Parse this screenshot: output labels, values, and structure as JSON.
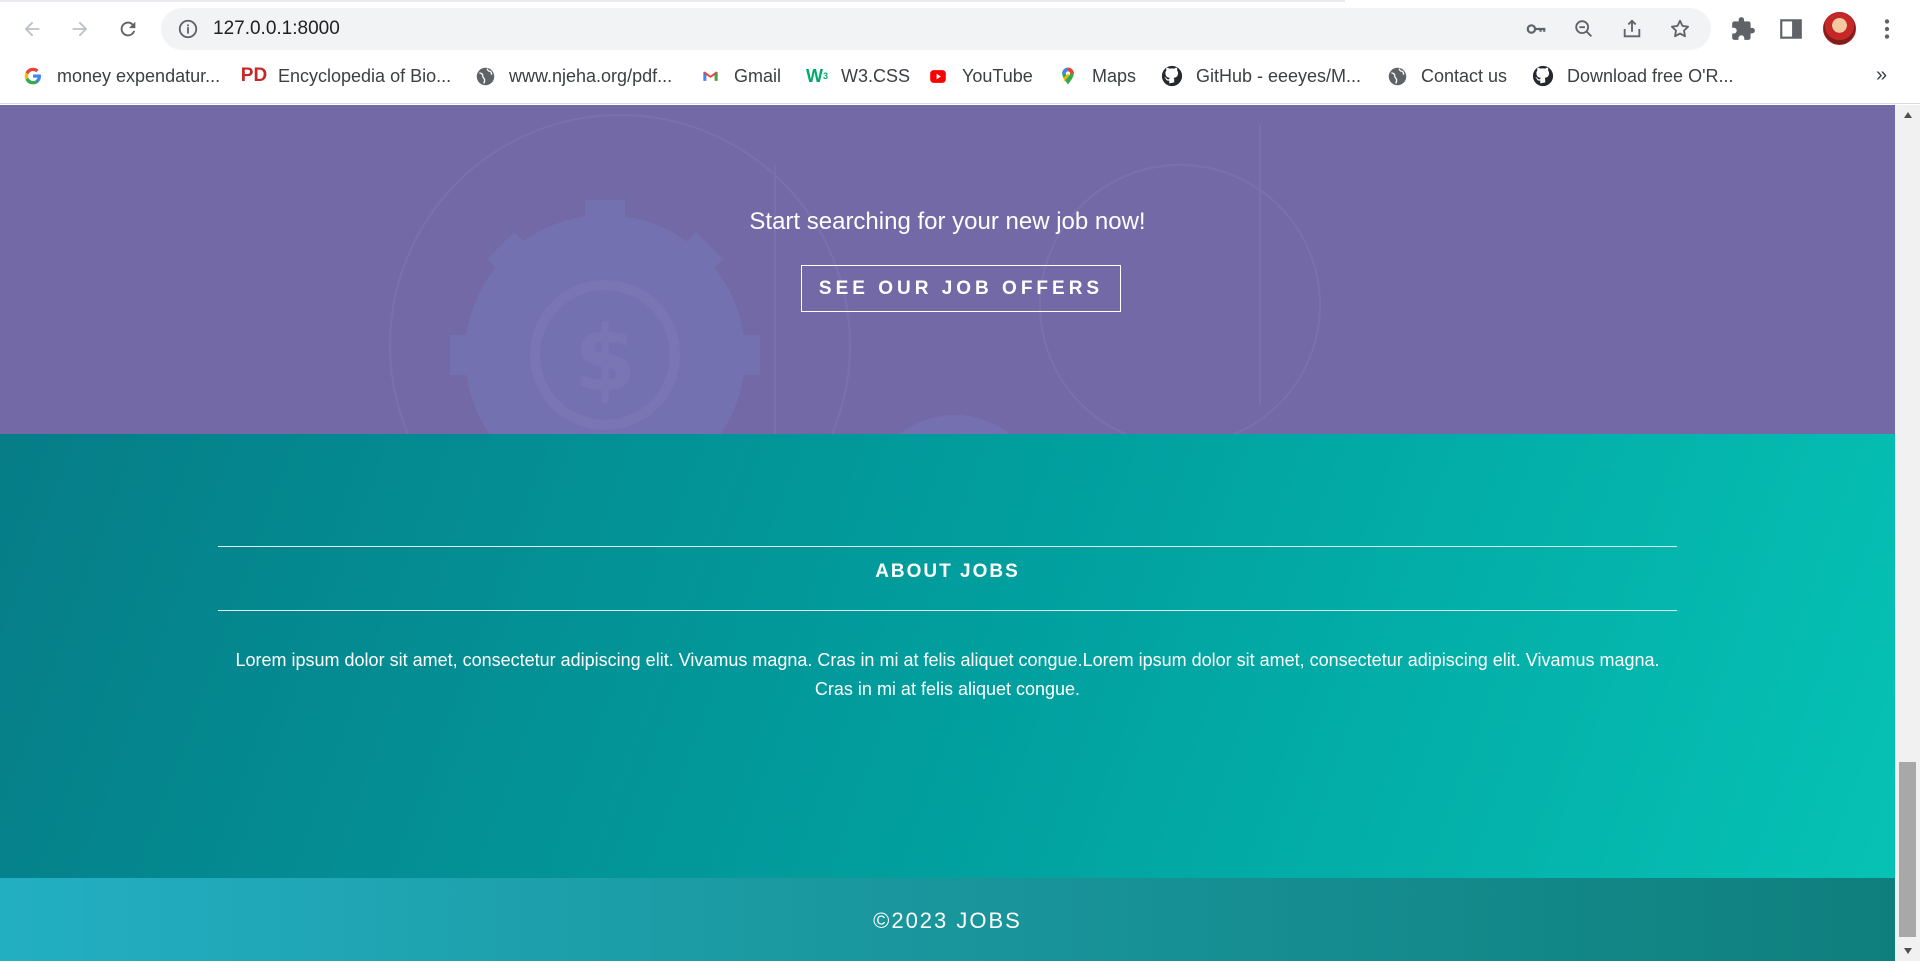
{
  "browser": {
    "url": "127.0.0.1:8000",
    "bookmarks": [
      {
        "label": "money expendatur...",
        "icon": "google-icon"
      },
      {
        "label": "Encyclopedia of Bio...",
        "icon": "pd-icon"
      },
      {
        "label": "www.njeha.org/pdf...",
        "icon": "globe-icon"
      },
      {
        "label": "Gmail",
        "icon": "gmail-icon"
      },
      {
        "label": "W3.CSS",
        "icon": "w3-icon"
      },
      {
        "label": "YouTube",
        "icon": "youtube-icon"
      },
      {
        "label": "Maps",
        "icon": "maps-icon"
      },
      {
        "label": "GitHub - eeeyes/M...",
        "icon": "github-icon"
      },
      {
        "label": "Contact us",
        "icon": "globe-icon"
      },
      {
        "label": "Download free O'R...",
        "icon": "github-icon"
      }
    ],
    "more_label": "»"
  },
  "hero": {
    "tagline": "Start searching for your new job now!",
    "button_label": "SEE OUR JOB OFFERS",
    "background_color": "#7269a6"
  },
  "about": {
    "title": "ABOUT JOBS",
    "body": "Lorem ipsum dolor sit amet, consectetur adipiscing elit. Vivamus magna. Cras in mi at felis aliquet congue.Lorem ipsum dolor sit amet, consectetur adipiscing elit. Vivamus magna. Cras in mi at felis aliquet congue."
  },
  "footer": {
    "copyright": "©2023 JOBS"
  },
  "colors": {
    "accent_teal": "#01a1a0",
    "footer_teal": "#1b9aa2"
  }
}
